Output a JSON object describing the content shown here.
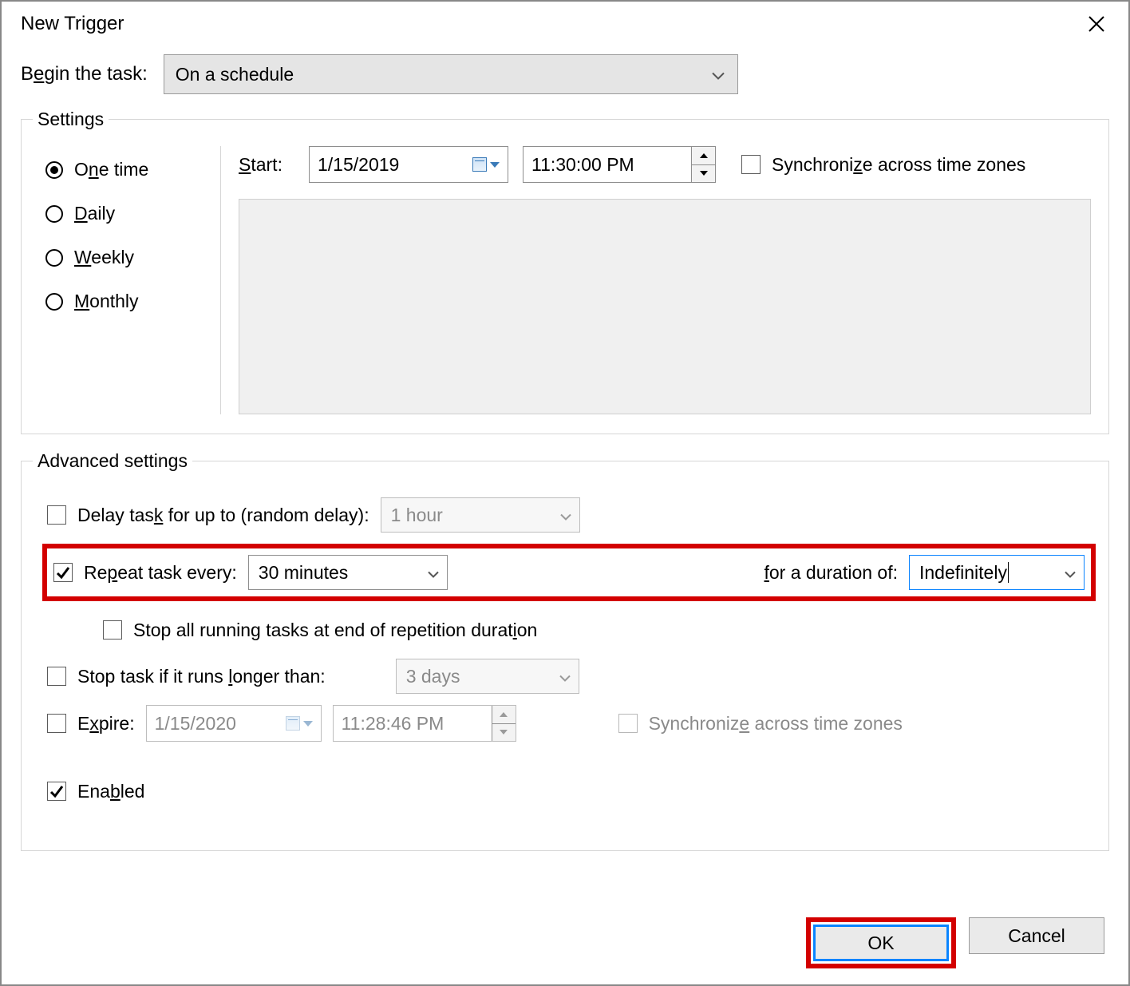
{
  "titlebar": {
    "title": "New Trigger"
  },
  "begin": {
    "label": "Begin the task:",
    "value": "On a schedule"
  },
  "settings": {
    "legend": "Settings",
    "radios": {
      "one_time": "One time",
      "daily": "Daily",
      "weekly": "Weekly",
      "monthly": "Monthly"
    },
    "start_label": "Start:",
    "start_date": "1/15/2019",
    "start_time": "11:30:00 PM",
    "sync_tz": "Synchronize across time zones"
  },
  "advanced": {
    "legend": "Advanced settings",
    "delay_label": "Delay task for up to (random delay):",
    "delay_value": "1 hour",
    "repeat_label": "Repeat task every:",
    "repeat_value": "30 minutes",
    "duration_label": "for a duration of:",
    "duration_value": "Indefinitely",
    "stop_all_label": "Stop all running tasks at end of repetition duration",
    "stop_if_label": "Stop task if it runs longer than:",
    "stop_if_value": "3 days",
    "expire_label": "Expire:",
    "expire_date": "1/15/2020",
    "expire_time": "11:28:46 PM",
    "sync_tz2": "Synchronize across time zones",
    "enabled_label": "Enabled"
  },
  "buttons": {
    "ok": "OK",
    "cancel": "Cancel"
  }
}
